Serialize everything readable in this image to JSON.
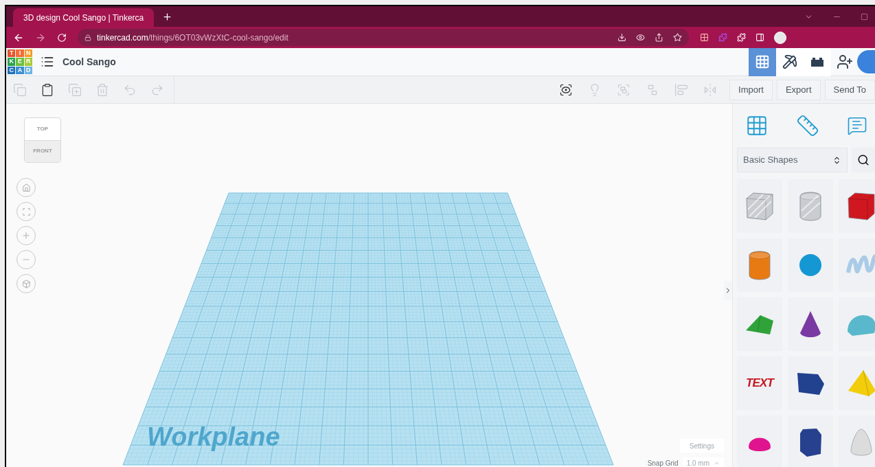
{
  "browser": {
    "tab": {
      "title": "3D design Cool Sango | Tinkerca"
    },
    "url": {
      "host": "tinkercad.com",
      "path": "/things/6OT03vWzXtC-cool-sango/edit"
    }
  },
  "app": {
    "logo": [
      "T",
      "I",
      "N",
      "K",
      "E",
      "R",
      "C",
      "A",
      "D"
    ],
    "title": "Cool Sango",
    "views": [
      {
        "kind": "grid",
        "selected": true
      },
      {
        "kind": "pickaxe",
        "selected": false
      },
      {
        "kind": "brick",
        "selected": false
      }
    ]
  },
  "toolbar": {
    "edit_tools": [
      {
        "kind": "copy",
        "disabled": true
      },
      {
        "kind": "paste",
        "disabled": false
      },
      {
        "kind": "duplicate",
        "disabled": true
      },
      {
        "kind": "delete",
        "disabled": true
      },
      {
        "kind": "undo",
        "disabled": true
      },
      {
        "kind": "redo",
        "disabled": true
      }
    ],
    "shape_tools": [
      {
        "kind": "notes",
        "disabled": false
      },
      {
        "kind": "light",
        "disabled": true
      },
      {
        "kind": "group",
        "disabled": true
      },
      {
        "kind": "ungroup",
        "disabled": true
      },
      {
        "kind": "align",
        "disabled": true
      },
      {
        "kind": "mirror",
        "disabled": true
      }
    ],
    "buttons": [
      "Import",
      "Export",
      "Send To"
    ]
  },
  "viewport": {
    "view_cube": {
      "top": "TOP",
      "front": "FRONT"
    },
    "workplane_label": "Workplane",
    "settings": "Settings",
    "snap_grid": {
      "label": "Snap Grid",
      "value": "1.0 mm"
    }
  },
  "panel": {
    "category": "Basic Shapes",
    "shapes": [
      {
        "kind": "box-hole",
        "color": "#c9ccd1"
      },
      {
        "kind": "cylinder-hole",
        "color": "#c9ccd1"
      },
      {
        "kind": "box",
        "color": "#d0171f"
      },
      {
        "kind": "cylinder",
        "color": "#e87a13"
      },
      {
        "kind": "sphere",
        "color": "#1597d4"
      },
      {
        "kind": "scribble",
        "color": "#a9cbe6"
      },
      {
        "kind": "roof",
        "color": "#2fa33a"
      },
      {
        "kind": "cone",
        "color": "#7b3aa3"
      },
      {
        "kind": "round-roof",
        "color": "#5ab8cc"
      },
      {
        "kind": "text",
        "color": "#c8141e",
        "label": "TEXT"
      },
      {
        "kind": "prism",
        "color": "#22418f"
      },
      {
        "kind": "pyramid",
        "color": "#f1cd0c"
      },
      {
        "kind": "half-sphere",
        "color": "#e0148e"
      },
      {
        "kind": "polygon",
        "color": "#27418f"
      },
      {
        "kind": "paraboloid",
        "color": "#dcdcdc"
      }
    ]
  }
}
